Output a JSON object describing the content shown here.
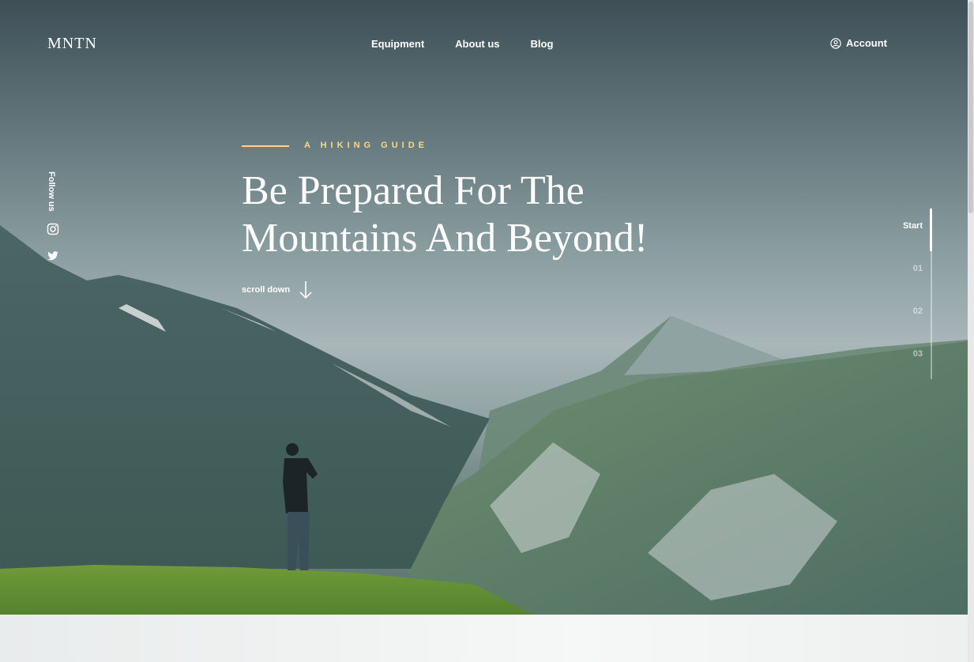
{
  "brand": {
    "logo": "MNTN"
  },
  "nav": {
    "items": [
      "Equipment",
      "About us",
      "Blog"
    ]
  },
  "account": {
    "label": "Account",
    "icon": "user-circle-icon"
  },
  "social": {
    "label": "Follow us",
    "icons": [
      "instagram-icon",
      "twitter-icon"
    ]
  },
  "hero": {
    "eyebrow": "A HIKING GUIDE",
    "title_line1": "Be Prepared For The",
    "title_line2": "Mountains And Beyond!",
    "scroll_label": "scroll down"
  },
  "steps": {
    "items": [
      "Start",
      "01",
      "02",
      "03"
    ],
    "active": "Start"
  },
  "colors": {
    "accent": "#FBD784",
    "text": "#FFFFFF"
  }
}
